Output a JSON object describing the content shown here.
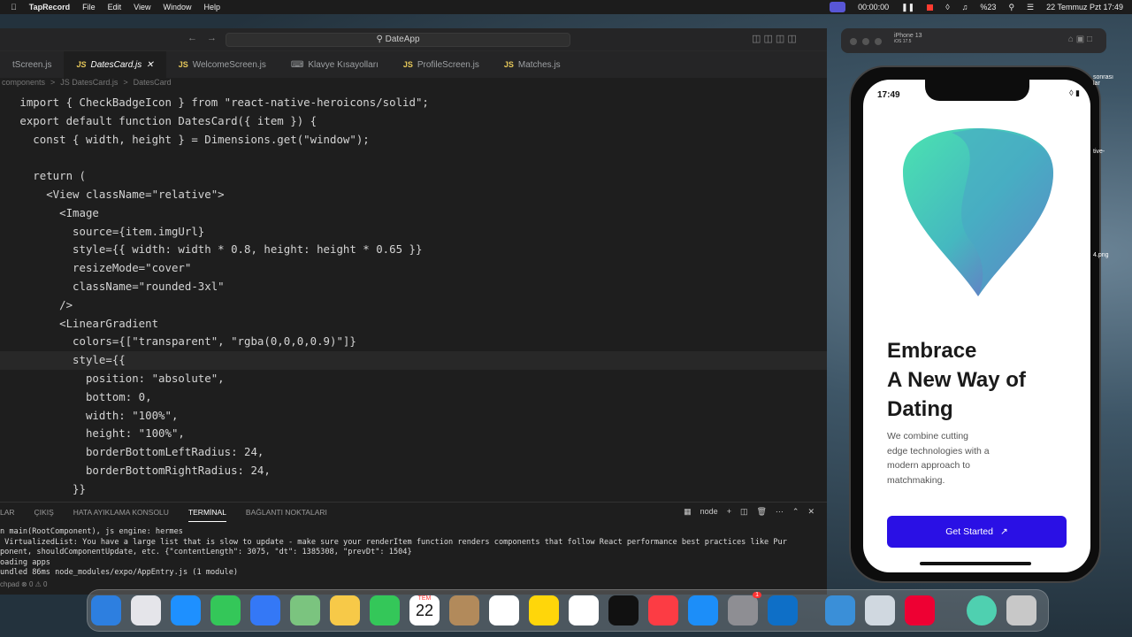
{
  "menubar": {
    "app": "TapRecord",
    "items": [
      "File",
      "Edit",
      "View",
      "Window",
      "Help"
    ],
    "recording_time": "00:00:00",
    "battery": "%23",
    "datetime": "22 Temmuz Pzt 17:49"
  },
  "editor": {
    "search": "DateApp",
    "tabs": [
      "tScreen.js",
      "DatesCard.js",
      "WelcomeScreen.js",
      "Klavye Kısayolları",
      "ProfileScreen.js",
      "Matches.js"
    ],
    "breadcrumb": [
      "components",
      ">",
      "JS DatesCard.js",
      ">",
      "DatesCard"
    ],
    "code_lines": [
      "import { CheckBadgeIcon } from \"react-native-heroicons/solid\";",
      "export default function DatesCard({ item }) {",
      "  const { width, height } = Dimensions.get(\"window\");",
      "",
      "  return (",
      "    <View className=\"relative\">",
      "      <Image",
      "        source={item.imgUrl}",
      "        style={{ width: width * 0.8, height: height * 0.65 }}",
      "        resizeMode=\"cover\"",
      "        className=\"rounded-3xl\"",
      "      />",
      "      <LinearGradient",
      "        colors={[\"transparent\", \"rgba(0,0,0,0.9)\"]}",
      "        style={{",
      "          position: \"absolute\",",
      "          bottom: 0,",
      "          width: \"100%\",",
      "          height: \"100%\",",
      "          borderBottomLeftRadius: 24,",
      "          borderBottomRightRadius: 24,",
      "        }}"
    ]
  },
  "panel": {
    "tabs": [
      "LAR",
      "ÇIKIŞ",
      "HATA AYIKLAMA KONSOLU",
      "TERMİNAL",
      "BAĞLANTI NOKTALARI"
    ],
    "active_tab": "TERMİNAL",
    "shell": "node",
    "lines": [
      "n main(RootComponent), js engine: hermes",
      " VirtualizedList: You have a large list that is slow to update - make sure your renderItem function renders components that follow React performance best practices like Pur",
      "ponent, shouldComponentUpdate, etc. {\"contentLength\": 3075, \"dt\": 1385308, \"prevDt\": 1504}",
      "oading apps",
      "undled 86ms node_modules/expo/AppEntry.js (1 module)"
    ],
    "status": "chpad  ⊗ 0 ⚠ 0"
  },
  "simulator": {
    "title": "iPhone 13",
    "subtitle": "iOS 17.5"
  },
  "phone": {
    "time": "17:49",
    "headline": [
      "Embrace",
      "A New Way of",
      "Dating"
    ],
    "subtitle": "We combine cutting edge technologies with a modern approach to matchmaking.",
    "cta": "Get Started",
    "brand_color": "#2a10e5"
  },
  "desktop_labels": {
    "a": "sonrası",
    "b": "lar",
    "c": "tive-",
    "d": "4.png"
  },
  "dock": {
    "calendar_month": "TEM",
    "calendar_day": "22",
    "settings_badge": "1"
  }
}
